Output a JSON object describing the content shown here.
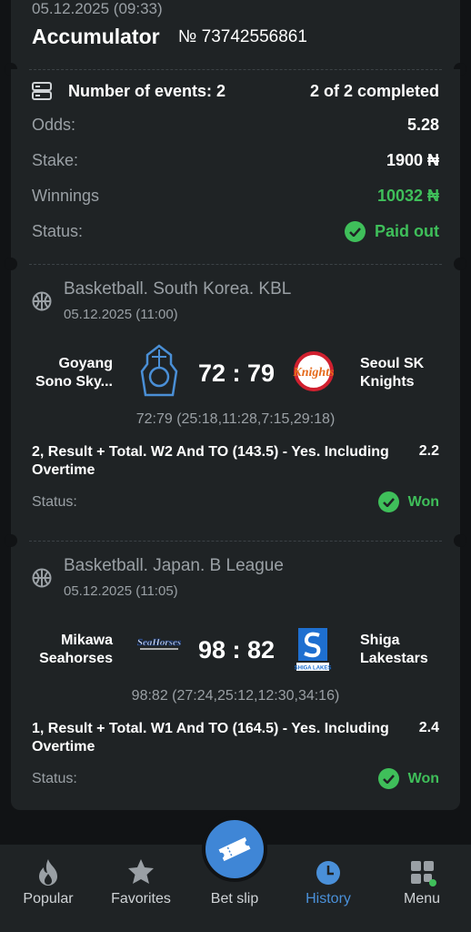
{
  "header": {
    "date": "05.12.2025 (09:33)",
    "title": "Accumulator",
    "ticket": "№ 73742556861"
  },
  "summary": {
    "events_label": "Number of events: 2",
    "completed": "2 of 2 completed",
    "odds_label": "Odds:",
    "odds_value": "5.28",
    "stake_label": "Stake:",
    "stake_value": "1900 ₦",
    "winnings_label": "Winnings",
    "winnings_value": "10032 ₦",
    "status_label": "Status:",
    "status_value": "Paid out"
  },
  "events": [
    {
      "sport": "Basketball. South Korea. KBL",
      "date": "05.12.2025 (11:00)",
      "home_line1": "Goyang",
      "home_line2": "Sono Sky...",
      "away_line1": "Seoul SK",
      "away_line2": "Knights",
      "score": "72 : 79",
      "periods": "72:79 (25:18,11:28,7:15,29:18)",
      "bet_line1": "2, Result + Total. W2 And TO (143.5) - Yes. Including",
      "bet_line2": "Overtime",
      "odd": "2.2",
      "status_label": "Status:",
      "status_value": "Won",
      "away_logo_text": "Knights"
    },
    {
      "sport": "Basketball. Japan. B League",
      "date": "05.12.2025 (11:05)",
      "home_line1": "Mikawa",
      "home_line2": "Seahorses",
      "away_line1": "Shiga",
      "away_line2": "Lakestars",
      "score": "98 : 82",
      "periods": "98:82 (27:24,25:12,12:30,34:16)",
      "bet_line1": "1, Result + Total. W1 And TO (164.5) - Yes. Including",
      "bet_line2": "Overtime",
      "odd": "2.4",
      "status_label": "Status:",
      "status_value": "Won",
      "home_logo_text": "SeaHorses",
      "away_logo_text": "SHIGA LAKES"
    }
  ],
  "nav": {
    "popular": "Popular",
    "favorites": "Favorites",
    "betslip": "Bet slip",
    "history": "History",
    "menu": "Menu",
    "active": "history",
    "accent_color": "#4a90d9"
  },
  "colors": {
    "background": "#111315",
    "card": "#1f2325",
    "success": "#3fbf5a",
    "muted": "#9aa0a5"
  }
}
